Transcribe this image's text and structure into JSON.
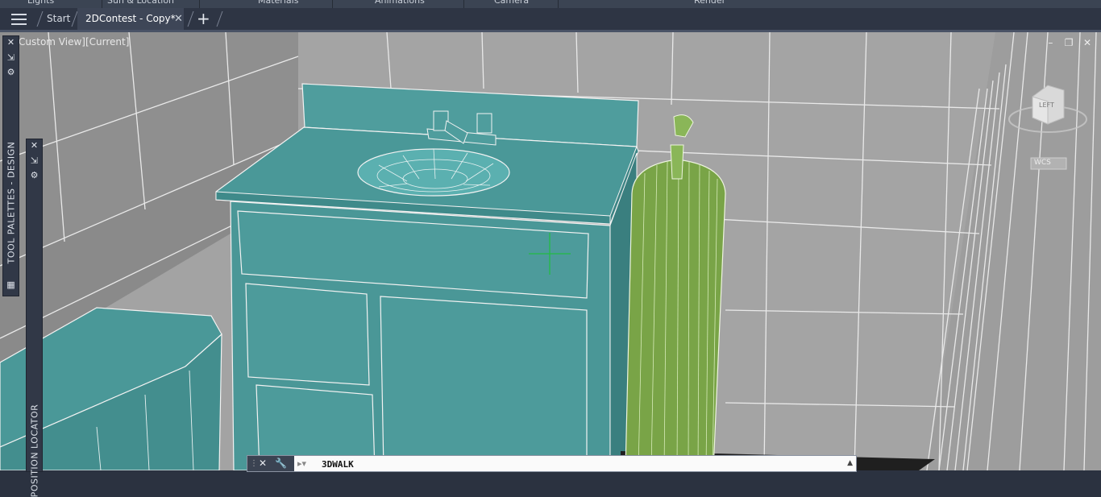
{
  "ribbon": {
    "panels": [
      "Lights",
      "Sun & Location",
      "Materials",
      "Animations",
      "Camera",
      "Render"
    ]
  },
  "tabs": {
    "start_label": "Start",
    "active_label": "2DContest - Copy*",
    "close_glyph": "✕",
    "new_glyph": "+"
  },
  "viewport": {
    "label": "Custom View][Current]",
    "controls": [
      "–",
      "❐",
      "✕"
    ]
  },
  "viewcube": {
    "face_label": "LEFT",
    "ucs_label": "WCS"
  },
  "palettes": {
    "tool_palettes_label": "TOOL PALETTES - DESIGN",
    "position_locator_label": "POSITION LOCATOR",
    "close_glyph": "✕"
  },
  "command_line": {
    "close_glyph": "✕",
    "customize_glyph": "🔧",
    "text": "3DWALK",
    "expand_glyph": "▲"
  },
  "colors": {
    "wall": "#a3a3a3",
    "vanity": "#4e9a9a",
    "cylinder": "#7aa04a",
    "crosshair": "#22bb44"
  }
}
